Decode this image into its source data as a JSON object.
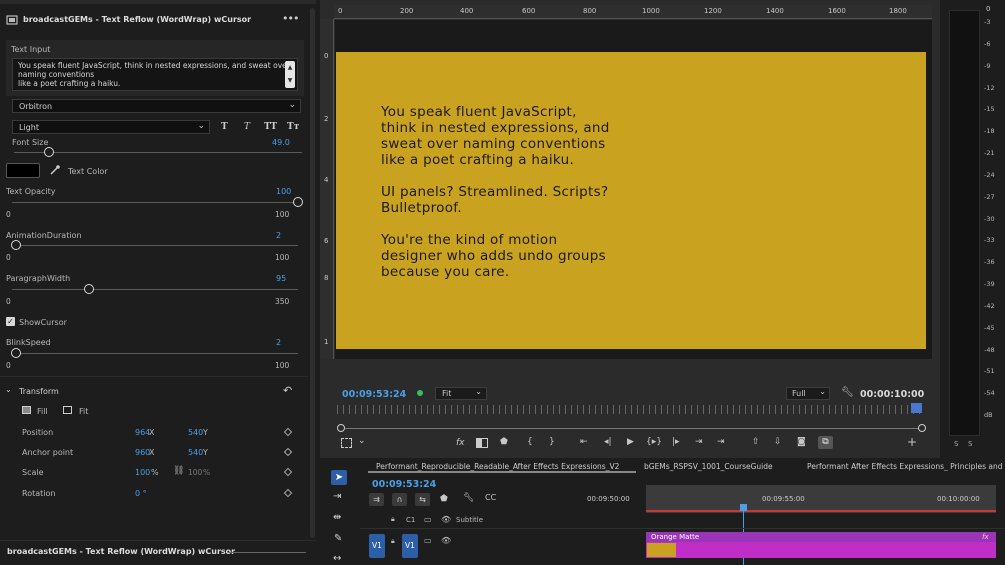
{
  "panel": {
    "title": "broadcastGEMs - Text Reflow (WordWrap) wCursor",
    "menu_icon": "more-horizontal-icon",
    "text_input_label": "Text Input",
    "text_lines": [
      "You speak fluent JavaScript, think in nested expressions, and sweat over",
      "naming conventions",
      "like a poet crafting a haiku."
    ],
    "font": "Orbitron",
    "weight": "Light",
    "style_buttons": [
      "T",
      "T",
      "TT",
      "Tт"
    ],
    "font_size_label": "Font Size",
    "font_size_value": "49.0",
    "text_color_label": "Text Color",
    "text_color": "#000000",
    "sliders": [
      {
        "label": "Text Opacity",
        "value": "100",
        "min": "0",
        "max": "100",
        "fraction": 1.0
      },
      {
        "label": "AnimationDuration",
        "value": "2",
        "min": "0",
        "max": "100",
        "fraction": 0.02
      },
      {
        "label": "ParagraphWidth",
        "value": "95",
        "min": "0",
        "max": "350",
        "fraction": 0.271
      }
    ],
    "show_cursor_label": "ShowCursor",
    "show_cursor_checked": true,
    "blink": {
      "label": "BlinkSpeed",
      "value": "2",
      "min": "0",
      "max": "100",
      "fraction": 0.02
    },
    "transform": {
      "title": "Transform",
      "fill_label": "Fill",
      "fit_label": "Fit",
      "position": {
        "label": "Position",
        "x": "964",
        "x_unit": "X",
        "y": "540",
        "y_unit": "Y"
      },
      "anchor": {
        "label": "Anchor point",
        "x": "960",
        "x_unit": "X",
        "y": "540",
        "y_unit": "Y"
      },
      "scale": {
        "label": "Scale",
        "value": "100",
        "unit": "%",
        "linked": "100",
        "linked_unit": "%"
      },
      "rotation": {
        "label": "Rotation",
        "value": "0 °"
      }
    },
    "footer_title": "broadcastGEMs - Text Reflow (WordWrap) wCursor"
  },
  "monitor": {
    "ruler_top": [
      "0",
      "200",
      "400",
      "600",
      "800",
      "1000",
      "1200",
      "1400",
      "1600",
      "1800"
    ],
    "ruler_left": [
      "0",
      "2",
      "4",
      "6",
      "8",
      "1"
    ],
    "frame_color": "#c9a21f",
    "paragraphs": [
      [
        "You speak fluent JavaScript,",
        "think in nested expressions, and",
        "sweat over naming conventions",
        "like a poet crafting a haiku."
      ],
      [
        "UI panels? Streamlined. Scripts?",
        "Bulletproof."
      ],
      [
        "You're the kind of motion",
        "designer who adds undo groups",
        "because you care."
      ]
    ],
    "timecode": "00:09:53:24",
    "zoom": "Fit",
    "quality": "Full",
    "duration": "00:00:10:00",
    "transport_icons": [
      "mark-in-icon",
      "mark-out-icon",
      "mark-clip-icon",
      "go-to-in-icon",
      "step-back-icon",
      "play-icon",
      "play-around-icon",
      "step-forward-icon",
      "go-to-out-icon",
      "lift-icon",
      "extract-icon",
      "export-frame-icon",
      "comparison-view-icon"
    ],
    "transport_glyphs": [
      "{",
      "}",
      "⇤",
      "◂|",
      "▶",
      "{▸}",
      "|▸",
      "⇥",
      "⇧",
      "⇩",
      "◙",
      "⧉"
    ]
  },
  "meter": {
    "top_label": "0",
    "scale": [
      "-3",
      "-6",
      "-9",
      "-12",
      "-15",
      "-18",
      "-21",
      "-24",
      "-27",
      "-30",
      "-33",
      "-36",
      "-39",
      "-42",
      "-45",
      "-48",
      "-51",
      "-54",
      "dB"
    ],
    "solo": [
      "S",
      "S"
    ]
  },
  "timeline": {
    "tabs": [
      "Performant_Reproducible_Readable_After Effects Expressions_V2",
      "bGEMs_RSPSV_1001_CourseGuide",
      "Performant After Effects Expressions_ Principles and Optim"
    ],
    "timecode": "00:09:53:24",
    "ruler": [
      "00:09:50:00",
      "00:09:55:00",
      "00:10:00:00"
    ],
    "track_c1": "C1",
    "subtitle_label": "Subtitle",
    "track_v1": "V1",
    "clip_name": "Orange Matte",
    "clip_fx": "fx"
  },
  "colors": {
    "accent": "#4a9fea",
    "clip": "#c12ec7",
    "clip_header": "#9b35b8",
    "matte": "#c9a21f"
  }
}
